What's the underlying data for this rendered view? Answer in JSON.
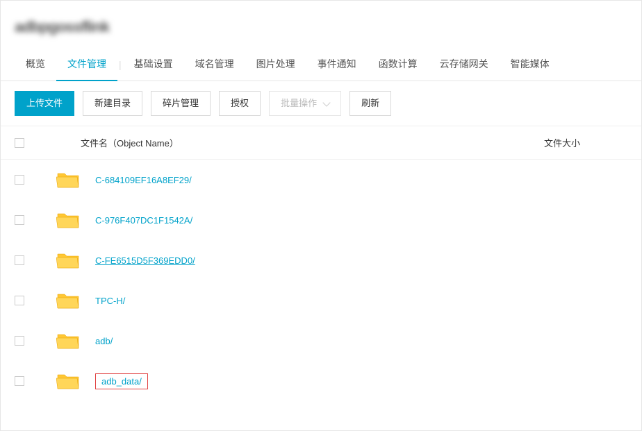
{
  "header": {
    "title": "adbpgossflink"
  },
  "tabs": {
    "items": [
      {
        "label": "概览",
        "active": false
      },
      {
        "label": "文件管理",
        "active": true
      },
      {
        "label": "基础设置",
        "active": false
      },
      {
        "label": "域名管理",
        "active": false
      },
      {
        "label": "图片处理",
        "active": false
      },
      {
        "label": "事件通知",
        "active": false
      },
      {
        "label": "函数计算",
        "active": false
      },
      {
        "label": "云存储网关",
        "active": false
      },
      {
        "label": "智能媒体",
        "active": false
      }
    ]
  },
  "toolbar": {
    "upload": "上传文件",
    "newdir": "新建目录",
    "fragments": "碎片管理",
    "auth": "授权",
    "batch": "批量操作",
    "refresh": "刷新"
  },
  "table": {
    "headers": {
      "name": "文件名（Object Name）",
      "size": "文件大小"
    },
    "rows": [
      {
        "name": "C-684109EF16A8EF29/",
        "underlined": false,
        "highlighted": false
      },
      {
        "name": "C-976F407DC1F1542A/",
        "underlined": false,
        "highlighted": false
      },
      {
        "name": "C-FE6515D5F369EDD0/",
        "underlined": true,
        "highlighted": false
      },
      {
        "name": "TPC-H/",
        "underlined": false,
        "highlighted": false
      },
      {
        "name": "adb/",
        "underlined": false,
        "highlighted": false
      },
      {
        "name": "adb_data/",
        "underlined": false,
        "highlighted": true
      }
    ]
  }
}
